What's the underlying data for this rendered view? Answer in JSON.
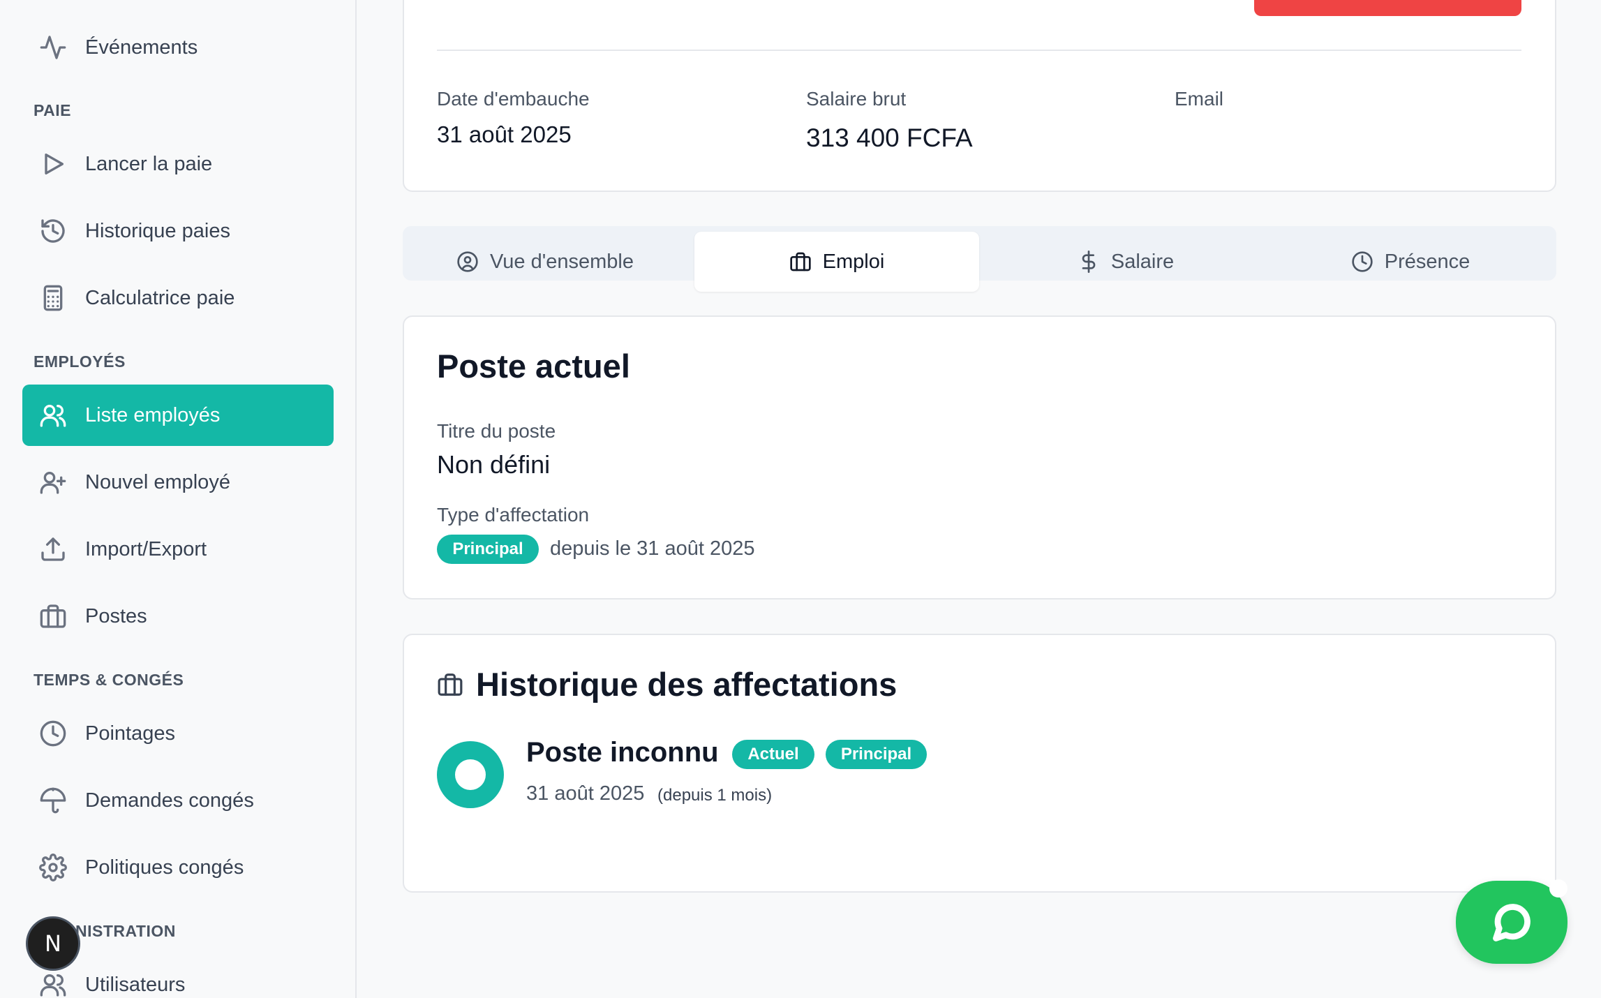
{
  "sidebar": {
    "items": [
      {
        "label": "Événements",
        "icon": "activity-icon"
      },
      {
        "label": "Lancer la paie",
        "icon": "play-icon"
      },
      {
        "label": "Historique paies",
        "icon": "history-icon"
      },
      {
        "label": "Calculatrice paie",
        "icon": "calculator-icon"
      },
      {
        "label": "Liste employés",
        "icon": "users-icon",
        "active": true
      },
      {
        "label": "Nouvel employé",
        "icon": "user-plus-icon"
      },
      {
        "label": "Import/Export",
        "icon": "upload-icon"
      },
      {
        "label": "Postes",
        "icon": "briefcase-icon"
      },
      {
        "label": "Pointages",
        "icon": "clock-icon"
      },
      {
        "label": "Demandes congés",
        "icon": "umbrella-icon"
      },
      {
        "label": "Politiques congés",
        "icon": "settings-icon"
      },
      {
        "label": "Utilisateurs",
        "icon": "users-icon"
      }
    ],
    "sections": {
      "paie": "PAIE",
      "employes": "EMPLOYÉS",
      "temps": "TEMPS & CONGÉS",
      "admin": "NISTRATION"
    },
    "badge_letter": "N"
  },
  "summary": {
    "hire_date_label": "Date d'embauche",
    "hire_date_value": "31 août 2025",
    "salary_label": "Salaire brut",
    "salary_value": "313 400 FCFA",
    "email_label": "Email"
  },
  "tabs": [
    {
      "label": "Vue d'ensemble",
      "icon": "user-circle-icon"
    },
    {
      "label": "Emploi",
      "icon": "briefcase-icon",
      "active": true
    },
    {
      "label": "Salaire",
      "icon": "dollar-icon"
    },
    {
      "label": "Présence",
      "icon": "clock-icon"
    }
  ],
  "current_position": {
    "title": "Poste actuel",
    "job_title_label": "Titre du poste",
    "job_title_value": "Non défini",
    "assignment_type_label": "Type d'affectation",
    "assignment_badge": "Principal",
    "since_text": "depuis le 31 août 2025"
  },
  "history": {
    "title": "Historique des affectations",
    "entry": {
      "name": "Poste inconnu",
      "badge_current": "Actuel",
      "badge_type": "Principal",
      "date": "31 août 2025",
      "duration": "(depuis 1 mois)"
    }
  },
  "colors": {
    "accent": "#14b8a6",
    "danger": "#ef4444",
    "chat": "#22c55e"
  }
}
